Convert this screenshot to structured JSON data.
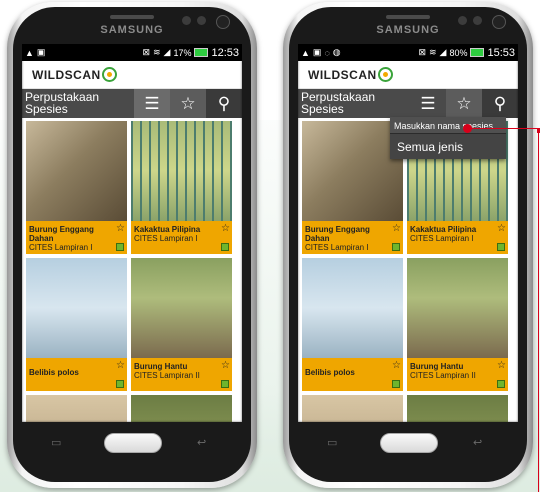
{
  "phone": {
    "brand": "SAMSUNG"
  },
  "status_left": {
    "time": "12:53",
    "battery": "17%"
  },
  "status_right": {
    "time": "15:53",
    "battery": "80%"
  },
  "app": {
    "logo": "WILDSCAN",
    "page_title": "Perpustakaan Spesies"
  },
  "toolbar": {
    "menu_icon": "menu-icon",
    "star_icon": "star-icon",
    "search_icon": "search-icon"
  },
  "species": [
    {
      "name": "Burung Enggang Dahan",
      "cites": "CITES Lampiran I"
    },
    {
      "name": "Kakaktua Pilipina",
      "cites": "CITES Lampiran I"
    },
    {
      "name": "Belibis polos",
      "cites": ""
    },
    {
      "name": "Burung Hantu",
      "cites": "CITES Lampiran II"
    }
  ],
  "dropdown": {
    "search_placeholder": "Masukkan nama spesies",
    "item_all": "Semua jenis"
  },
  "colors": {
    "caption_bg": "#efa600",
    "toolbar_bg": "#4a4a4a",
    "annotation": "#d8001a"
  }
}
